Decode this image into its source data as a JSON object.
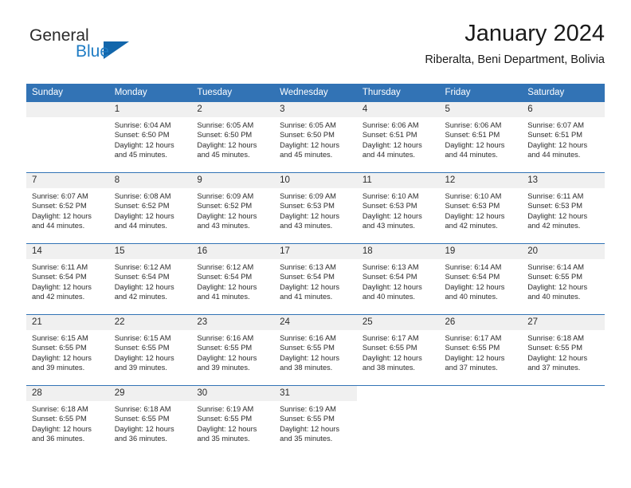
{
  "logo": {
    "word1": "General",
    "word2": "Blue",
    "triangle_color": "#1266ab",
    "blue_text_color": "#1f7cc4"
  },
  "header": {
    "title": "January 2024",
    "subtitle": "Riberalta, Beni Department, Bolivia"
  },
  "theme": {
    "header_blue": "#3273b5",
    "daynum_gray": "#f0f0f0",
    "text": "#2b2b2b"
  },
  "calendar": {
    "weekdays": [
      "Sunday",
      "Monday",
      "Tuesday",
      "Wednesday",
      "Thursday",
      "Friday",
      "Saturday"
    ],
    "weeks": [
      [
        {
          "day": "",
          "lines": []
        },
        {
          "day": "1",
          "lines": [
            "Sunrise: 6:04 AM",
            "Sunset: 6:50 PM",
            "Daylight: 12 hours",
            "and 45 minutes."
          ]
        },
        {
          "day": "2",
          "lines": [
            "Sunrise: 6:05 AM",
            "Sunset: 6:50 PM",
            "Daylight: 12 hours",
            "and 45 minutes."
          ]
        },
        {
          "day": "3",
          "lines": [
            "Sunrise: 6:05 AM",
            "Sunset: 6:50 PM",
            "Daylight: 12 hours",
            "and 45 minutes."
          ]
        },
        {
          "day": "4",
          "lines": [
            "Sunrise: 6:06 AM",
            "Sunset: 6:51 PM",
            "Daylight: 12 hours",
            "and 44 minutes."
          ]
        },
        {
          "day": "5",
          "lines": [
            "Sunrise: 6:06 AM",
            "Sunset: 6:51 PM",
            "Daylight: 12 hours",
            "and 44 minutes."
          ]
        },
        {
          "day": "6",
          "lines": [
            "Sunrise: 6:07 AM",
            "Sunset: 6:51 PM",
            "Daylight: 12 hours",
            "and 44 minutes."
          ]
        }
      ],
      [
        {
          "day": "7",
          "lines": [
            "Sunrise: 6:07 AM",
            "Sunset: 6:52 PM",
            "Daylight: 12 hours",
            "and 44 minutes."
          ]
        },
        {
          "day": "8",
          "lines": [
            "Sunrise: 6:08 AM",
            "Sunset: 6:52 PM",
            "Daylight: 12 hours",
            "and 44 minutes."
          ]
        },
        {
          "day": "9",
          "lines": [
            "Sunrise: 6:09 AM",
            "Sunset: 6:52 PM",
            "Daylight: 12 hours",
            "and 43 minutes."
          ]
        },
        {
          "day": "10",
          "lines": [
            "Sunrise: 6:09 AM",
            "Sunset: 6:53 PM",
            "Daylight: 12 hours",
            "and 43 minutes."
          ]
        },
        {
          "day": "11",
          "lines": [
            "Sunrise: 6:10 AM",
            "Sunset: 6:53 PM",
            "Daylight: 12 hours",
            "and 43 minutes."
          ]
        },
        {
          "day": "12",
          "lines": [
            "Sunrise: 6:10 AM",
            "Sunset: 6:53 PM",
            "Daylight: 12 hours",
            "and 42 minutes."
          ]
        },
        {
          "day": "13",
          "lines": [
            "Sunrise: 6:11 AM",
            "Sunset: 6:53 PM",
            "Daylight: 12 hours",
            "and 42 minutes."
          ]
        }
      ],
      [
        {
          "day": "14",
          "lines": [
            "Sunrise: 6:11 AM",
            "Sunset: 6:54 PM",
            "Daylight: 12 hours",
            "and 42 minutes."
          ]
        },
        {
          "day": "15",
          "lines": [
            "Sunrise: 6:12 AM",
            "Sunset: 6:54 PM",
            "Daylight: 12 hours",
            "and 42 minutes."
          ]
        },
        {
          "day": "16",
          "lines": [
            "Sunrise: 6:12 AM",
            "Sunset: 6:54 PM",
            "Daylight: 12 hours",
            "and 41 minutes."
          ]
        },
        {
          "day": "17",
          "lines": [
            "Sunrise: 6:13 AM",
            "Sunset: 6:54 PM",
            "Daylight: 12 hours",
            "and 41 minutes."
          ]
        },
        {
          "day": "18",
          "lines": [
            "Sunrise: 6:13 AM",
            "Sunset: 6:54 PM",
            "Daylight: 12 hours",
            "and 40 minutes."
          ]
        },
        {
          "day": "19",
          "lines": [
            "Sunrise: 6:14 AM",
            "Sunset: 6:54 PM",
            "Daylight: 12 hours",
            "and 40 minutes."
          ]
        },
        {
          "day": "20",
          "lines": [
            "Sunrise: 6:14 AM",
            "Sunset: 6:55 PM",
            "Daylight: 12 hours",
            "and 40 minutes."
          ]
        }
      ],
      [
        {
          "day": "21",
          "lines": [
            "Sunrise: 6:15 AM",
            "Sunset: 6:55 PM",
            "Daylight: 12 hours",
            "and 39 minutes."
          ]
        },
        {
          "day": "22",
          "lines": [
            "Sunrise: 6:15 AM",
            "Sunset: 6:55 PM",
            "Daylight: 12 hours",
            "and 39 minutes."
          ]
        },
        {
          "day": "23",
          "lines": [
            "Sunrise: 6:16 AM",
            "Sunset: 6:55 PM",
            "Daylight: 12 hours",
            "and 39 minutes."
          ]
        },
        {
          "day": "24",
          "lines": [
            "Sunrise: 6:16 AM",
            "Sunset: 6:55 PM",
            "Daylight: 12 hours",
            "and 38 minutes."
          ]
        },
        {
          "day": "25",
          "lines": [
            "Sunrise: 6:17 AM",
            "Sunset: 6:55 PM",
            "Daylight: 12 hours",
            "and 38 minutes."
          ]
        },
        {
          "day": "26",
          "lines": [
            "Sunrise: 6:17 AM",
            "Sunset: 6:55 PM",
            "Daylight: 12 hours",
            "and 37 minutes."
          ]
        },
        {
          "day": "27",
          "lines": [
            "Sunrise: 6:18 AM",
            "Sunset: 6:55 PM",
            "Daylight: 12 hours",
            "and 37 minutes."
          ]
        }
      ],
      [
        {
          "day": "28",
          "lines": [
            "Sunrise: 6:18 AM",
            "Sunset: 6:55 PM",
            "Daylight: 12 hours",
            "and 36 minutes."
          ]
        },
        {
          "day": "29",
          "lines": [
            "Sunrise: 6:18 AM",
            "Sunset: 6:55 PM",
            "Daylight: 12 hours",
            "and 36 minutes."
          ]
        },
        {
          "day": "30",
          "lines": [
            "Sunrise: 6:19 AM",
            "Sunset: 6:55 PM",
            "Daylight: 12 hours",
            "and 35 minutes."
          ]
        },
        {
          "day": "31",
          "lines": [
            "Sunrise: 6:19 AM",
            "Sunset: 6:55 PM",
            "Daylight: 12 hours",
            "and 35 minutes."
          ]
        },
        {
          "day": "",
          "lines": []
        },
        {
          "day": "",
          "lines": []
        },
        {
          "day": "",
          "lines": []
        }
      ]
    ]
  }
}
